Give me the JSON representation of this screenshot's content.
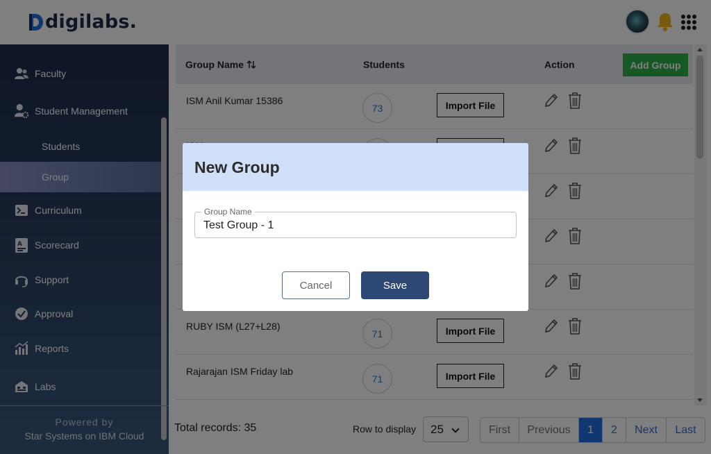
{
  "header": {
    "logo_text": "digilabs.",
    "avatar": "avatar-image",
    "notification_icon": "bell-icon",
    "apps_icon": "apps-grid-icon"
  },
  "sidebar": {
    "items": [
      {
        "label": "Faculty",
        "icon": "users-icon"
      },
      {
        "label": "Student Management",
        "icon": "user-gear-icon"
      },
      {
        "label": "Students",
        "sub": true
      },
      {
        "label": "Group",
        "sub": true,
        "active": true
      },
      {
        "label": "Curriculum",
        "icon": "terminal-icon"
      },
      {
        "label": "Scorecard",
        "icon": "scorecard-icon"
      },
      {
        "label": "Support",
        "icon": "headset-icon"
      },
      {
        "label": "Approval",
        "icon": "check-circle-icon"
      },
      {
        "label": "Reports",
        "icon": "bar-chart-icon"
      },
      {
        "label": "Labs",
        "icon": "labs-icon"
      }
    ],
    "footer_line1": "Powered by",
    "footer_line2": "Star Systems on IBM Cloud"
  },
  "table": {
    "headers": {
      "group_name": "Group Name",
      "students": "Students",
      "action": "Action"
    },
    "sort_icon": "sort-arrows-icon",
    "add_button": "Add Group",
    "import_label": "Import File",
    "rows": [
      {
        "name": "ISM Anil Kumar 15386",
        "count": "73"
      },
      {
        "name": "ISM",
        "count": ""
      },
      {
        "name": "",
        "count": ""
      },
      {
        "name": "",
        "count": ""
      },
      {
        "name": "",
        "count": ""
      },
      {
        "name": "RUBY ISM (L27+L28)",
        "count": "71"
      },
      {
        "name": "Rajarajan ISM Friday lab",
        "count": "71"
      }
    ]
  },
  "footer": {
    "total_records": "Total records: 35",
    "row_to_display_label": "Row to display",
    "rows_per_page": "25",
    "pager": {
      "first": "First",
      "previous": "Previous",
      "pages": [
        "1",
        "2"
      ],
      "current": "1",
      "next": "Next",
      "last": "Last"
    }
  },
  "modal": {
    "title": "New Group",
    "field_label": "Group Name",
    "field_value": "Test Group - 1",
    "cancel": "Cancel",
    "save": "Save"
  },
  "colors": {
    "sidebar_top": "#1d2b4b",
    "accent_green": "#2eb34a",
    "save_button": "#2d4874",
    "modal_header": "#cfe0f8",
    "page_active": "#1f6fe0"
  }
}
